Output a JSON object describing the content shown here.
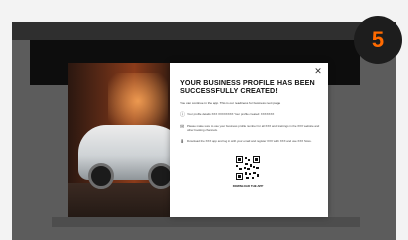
{
  "step_badge": "5",
  "modal": {
    "close_label": "✕",
    "title": "YOUR BUSINESS PROFILE HAS BEEN SUCCESSFULLY CREATED!",
    "intro": "You can continue in the app. This is our readiness for business next page",
    "items": [
      {
        "icon": "info-icon",
        "text": "Your profile details XXX XXXXXXXX  Your profile created: XXXXXXX"
      },
      {
        "icon": "mail-icon",
        "text": "Please make sure to use your business profile number for all XXX and trainings in the XXX website and other booking channels."
      },
      {
        "icon": "download-icon",
        "text": "Download the XXX app and log in with your email and register XXX with XXX and use XXX Store."
      }
    ],
    "qr_label": "DOWNLOAD THE APP"
  }
}
